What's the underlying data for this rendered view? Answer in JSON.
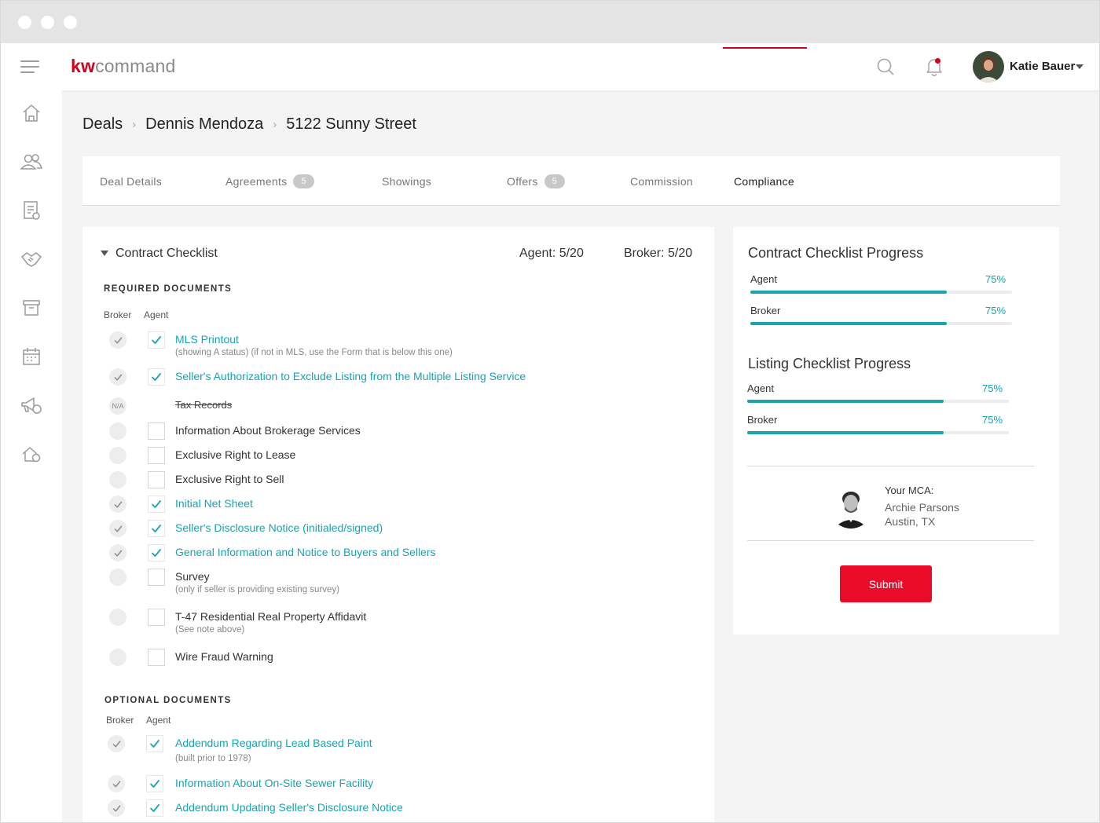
{
  "app": {
    "logo_kw": "kw",
    "logo_rest": "command"
  },
  "user": {
    "name": "Katie Bauer"
  },
  "breadcrumb": [
    "Deals",
    "Dennis Mendoza",
    "5122 Sunny Street"
  ],
  "tabs": [
    {
      "label": "Deal Details"
    },
    {
      "label": "Agreements",
      "badge": "5"
    },
    {
      "label": "Showings"
    },
    {
      "label": "Offers",
      "badge": "5"
    },
    {
      "label": "Commission"
    },
    {
      "label": "Compliance",
      "active": true
    }
  ],
  "checklist": {
    "title": "Contract Checklist",
    "agent_count": "Agent: 5/20",
    "broker_count": "Broker: 5/20",
    "required_heading": "REQUIRED DOCUMENTS",
    "optional_heading": "OPTIONAL DOCUMENTS",
    "col_broker": "Broker",
    "col_agent": "Agent",
    "required": [
      {
        "label": "MLS Printout",
        "sub": "(showing A status) (if not in MLS, use the Form that is below this one)",
        "broker": "checked",
        "agent": true
      },
      {
        "label": "Seller's Authorization to Exclude Listing from the Multiple Listing Service",
        "broker": "checked",
        "agent": true
      },
      {
        "label": "Tax Records",
        "broker": "na",
        "na_text": "N/A",
        "agent": null
      },
      {
        "label": "Information About Brokerage Services",
        "broker": "empty",
        "agent": false
      },
      {
        "label": "Exclusive Right to Lease",
        "broker": "empty",
        "agent": false
      },
      {
        "label": "Exclusive Right to Sell",
        "broker": "empty",
        "agent": false
      },
      {
        "label": "Initial Net Sheet",
        "broker": "checked",
        "agent": true
      },
      {
        "label": "Seller's Disclosure Notice (initialed/signed)",
        "broker": "checked",
        "agent": true
      },
      {
        "label": "General Information and Notice to Buyers and Sellers",
        "broker": "checked",
        "agent": true
      },
      {
        "label": "Survey",
        "sub": "(only if seller is providing existing survey)",
        "broker": "empty",
        "agent": false
      },
      {
        "label": "T-47 Residential Real Property Affidavit",
        "sub": "(See note above)",
        "broker": "empty",
        "agent": false
      },
      {
        "label": "Wire Fraud Warning",
        "broker": "empty",
        "agent": false
      }
    ],
    "optional": [
      {
        "label": "Addendum Regarding Lead Based Paint",
        "sub": "(built prior to 1978)",
        "broker": "checked",
        "agent": true
      },
      {
        "label": "Information About On-Site Sewer Facility",
        "broker": "checked",
        "agent": true
      },
      {
        "label": "Addendum Updating Seller's Disclosure Notice",
        "broker": "checked",
        "agent": true
      }
    ]
  },
  "progress": {
    "contract": {
      "title": "Contract Checklist Progress",
      "rows": [
        {
          "label": "Agent",
          "pct_text": "75%",
          "value": 0.75
        },
        {
          "label": "Broker",
          "pct_text": "75%",
          "value": 0.75
        }
      ]
    },
    "listing": {
      "title": "Listing Checklist Progress",
      "rows": [
        {
          "label": "Agent",
          "pct_text": "75%",
          "value": 0.75
        },
        {
          "label": "Broker",
          "pct_text": "75%",
          "value": 0.75
        }
      ]
    }
  },
  "mca": {
    "heading": "Your MCA:",
    "name": "Archie Parsons",
    "location": "Austin, TX"
  },
  "submit_label": "Submit",
  "colors": {
    "accent": "#1aa3b0",
    "brand": "#ce011f",
    "submit": "#ea0a2a"
  }
}
